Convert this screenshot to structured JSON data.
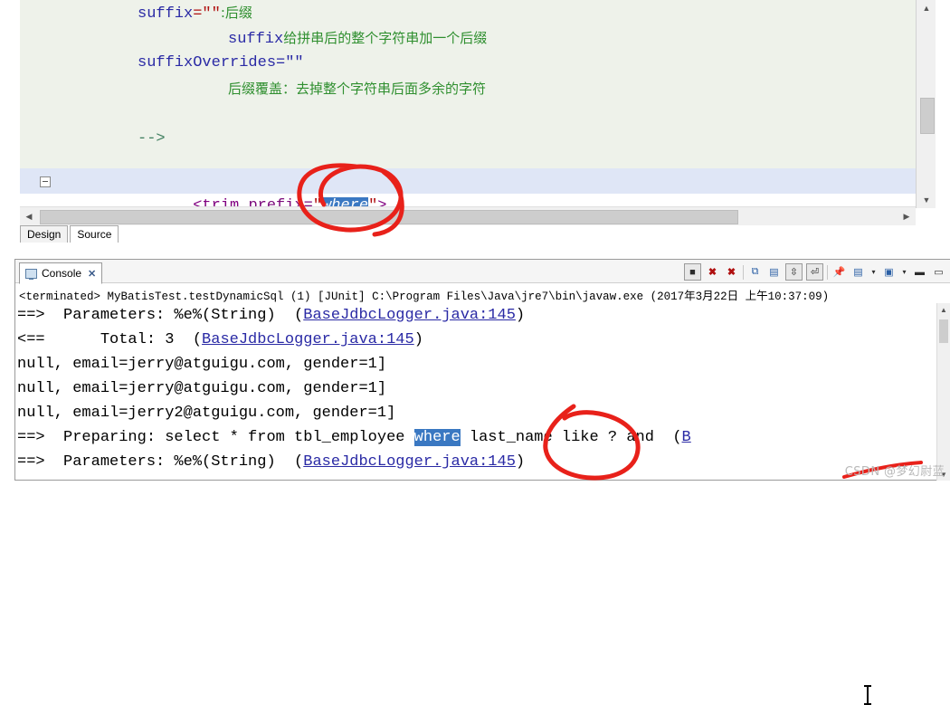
{
  "editor": {
    "lines": [
      {
        "indent": 130,
        "segments": [
          {
            "t": "suffix",
            "c": "kw-blue"
          },
          {
            "t": "=\"\"",
            "c": "str-red"
          },
          {
            "t": ":后缀",
            "c": "cn"
          }
        ]
      },
      {
        "indent": 230,
        "segments": [
          {
            "t": "suffix",
            "c": "kw-blue"
          },
          {
            "t": "给拼串后的整个字符串加一个后缀",
            "c": "cn"
          }
        ]
      },
      {
        "indent": 130,
        "segments": [
          {
            "t": "suffixOverrides=\"\"",
            "c": "kw-blue"
          }
        ]
      },
      {
        "indent": 230,
        "segments": [
          {
            "t": "后缀覆盖：去掉整个字符串后面多余的字符",
            "c": "cn"
          }
        ]
      },
      {
        "indent": 130,
        "segments": []
      },
      {
        "indent": 130,
        "segments": [
          {
            "t": "-->",
            "c": "comment-gray"
          }
        ]
      }
    ],
    "current_line": {
      "prefix_tag": "<trim ",
      "attr": "prefix=",
      "quote_open": "\"",
      "selected_value": "where",
      "quote_close": "\"",
      "tail": ">"
    },
    "scroll_icons": {
      "up": "up-arrow-icon",
      "down": "down-arrow-icon",
      "left": "left-arrow-icon",
      "right": "right-arrow-icon"
    },
    "tabs": [
      {
        "label": "Design",
        "active": false
      },
      {
        "label": "Source",
        "active": true
      }
    ]
  },
  "console": {
    "tab_label": "Console",
    "tab_close": "✕",
    "toolbar_icons": [
      "terminate-all-icon",
      "terminate-icon",
      "remove-launch-icon",
      "remove-all-terminated-icon",
      "copy-icon",
      "paste-icon",
      "scroll-lock-icon",
      "word-wrap-icon",
      "pin-console-icon",
      "display-selected-console-icon",
      "open-console-icon",
      "minimize-icon",
      "maximize-icon"
    ],
    "status_line": "<terminated> MyBatisTest.testDynamicSql (1) [JUnit] C:\\Program Files\\Java\\jre7\\bin\\javaw.exe (2017年3月22日 上午10:37:09)",
    "lines": [
      {
        "segments": [
          {
            "t": "==>  Parameters: %e%(String)  (",
            "c": ""
          },
          {
            "t": "BaseJdbcLogger.java:145",
            "c": "link"
          },
          {
            "t": ")",
            "c": ""
          }
        ]
      },
      {
        "segments": [
          {
            "t": "<==      Total: 3  (",
            "c": ""
          },
          {
            "t": "BaseJdbcLogger.java:145",
            "c": "link"
          },
          {
            "t": ")",
            "c": ""
          }
        ]
      },
      {
        "segments": [
          {
            "t": "null, email=jerry@atguigu.com, gender=1]",
            "c": ""
          }
        ]
      },
      {
        "segments": [
          {
            "t": "null, email=jerry@atguigu.com, gender=1]",
            "c": ""
          }
        ]
      },
      {
        "segments": [
          {
            "t": "null, email=jerry2@atguigu.com, gender=1]",
            "c": ""
          }
        ]
      },
      {
        "segments": [
          {
            "t": "==>  Preparing: select * from tbl_employee ",
            "c": ""
          },
          {
            "t": "where",
            "c": "sel-where2"
          },
          {
            "t": " last_name like ? and",
            "c": ""
          },
          {
            "t": "  (",
            "c": ""
          },
          {
            "t": "B",
            "c": "link"
          }
        ]
      },
      {
        "segments": [
          {
            "t": "==>  Parameters: %e%(String)  (",
            "c": ""
          },
          {
            "t": "BaseJdbcLogger.java:145",
            "c": "link"
          },
          {
            "t": ")",
            "c": ""
          }
        ]
      }
    ],
    "scroll_icons": {
      "up": "up-arrow-icon",
      "down": "down-arrow-icon"
    }
  },
  "annotations": {
    "ellipse_editor": "red-hand-drawn-ellipse-around-where-attribute",
    "ellipse_console": "red-hand-drawn-ellipse-around-where-keyword",
    "underline_console": "red-hand-drawn-underline"
  },
  "watermark": "CSDN @梦幻尉蓝",
  "colors": {
    "selection_blue": "#3a78c2",
    "annotation_red": "#e8211a",
    "editor_bg": "#eef2ea",
    "current_line": "#dfe6f6",
    "link_blue": "#2a2aa5",
    "comment_green": "#2f8f2f"
  }
}
